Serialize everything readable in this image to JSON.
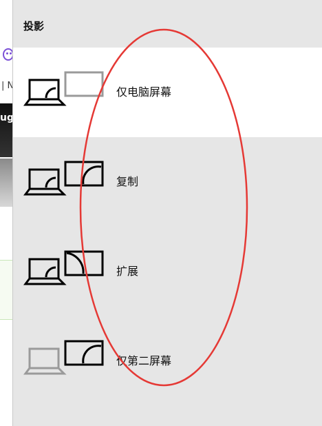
{
  "background_app": {
    "tab_text": "| N",
    "dark_band_text": "ugi"
  },
  "panel": {
    "title": "投影",
    "options": [
      {
        "label": "仅电脑屏幕",
        "selected": true,
        "mode": "pc-only"
      },
      {
        "label": "复制",
        "selected": false,
        "mode": "duplicate"
      },
      {
        "label": "扩展",
        "selected": false,
        "mode": "extend"
      },
      {
        "label": "仅第二屏幕",
        "selected": false,
        "mode": "second-only"
      }
    ]
  },
  "colors": {
    "panel_bg": "#e6e6e6",
    "selected_bg": "#ffffff",
    "icon_active": "#000000",
    "icon_inactive": "#9a9a9a",
    "annotation_red": "#e53935"
  }
}
